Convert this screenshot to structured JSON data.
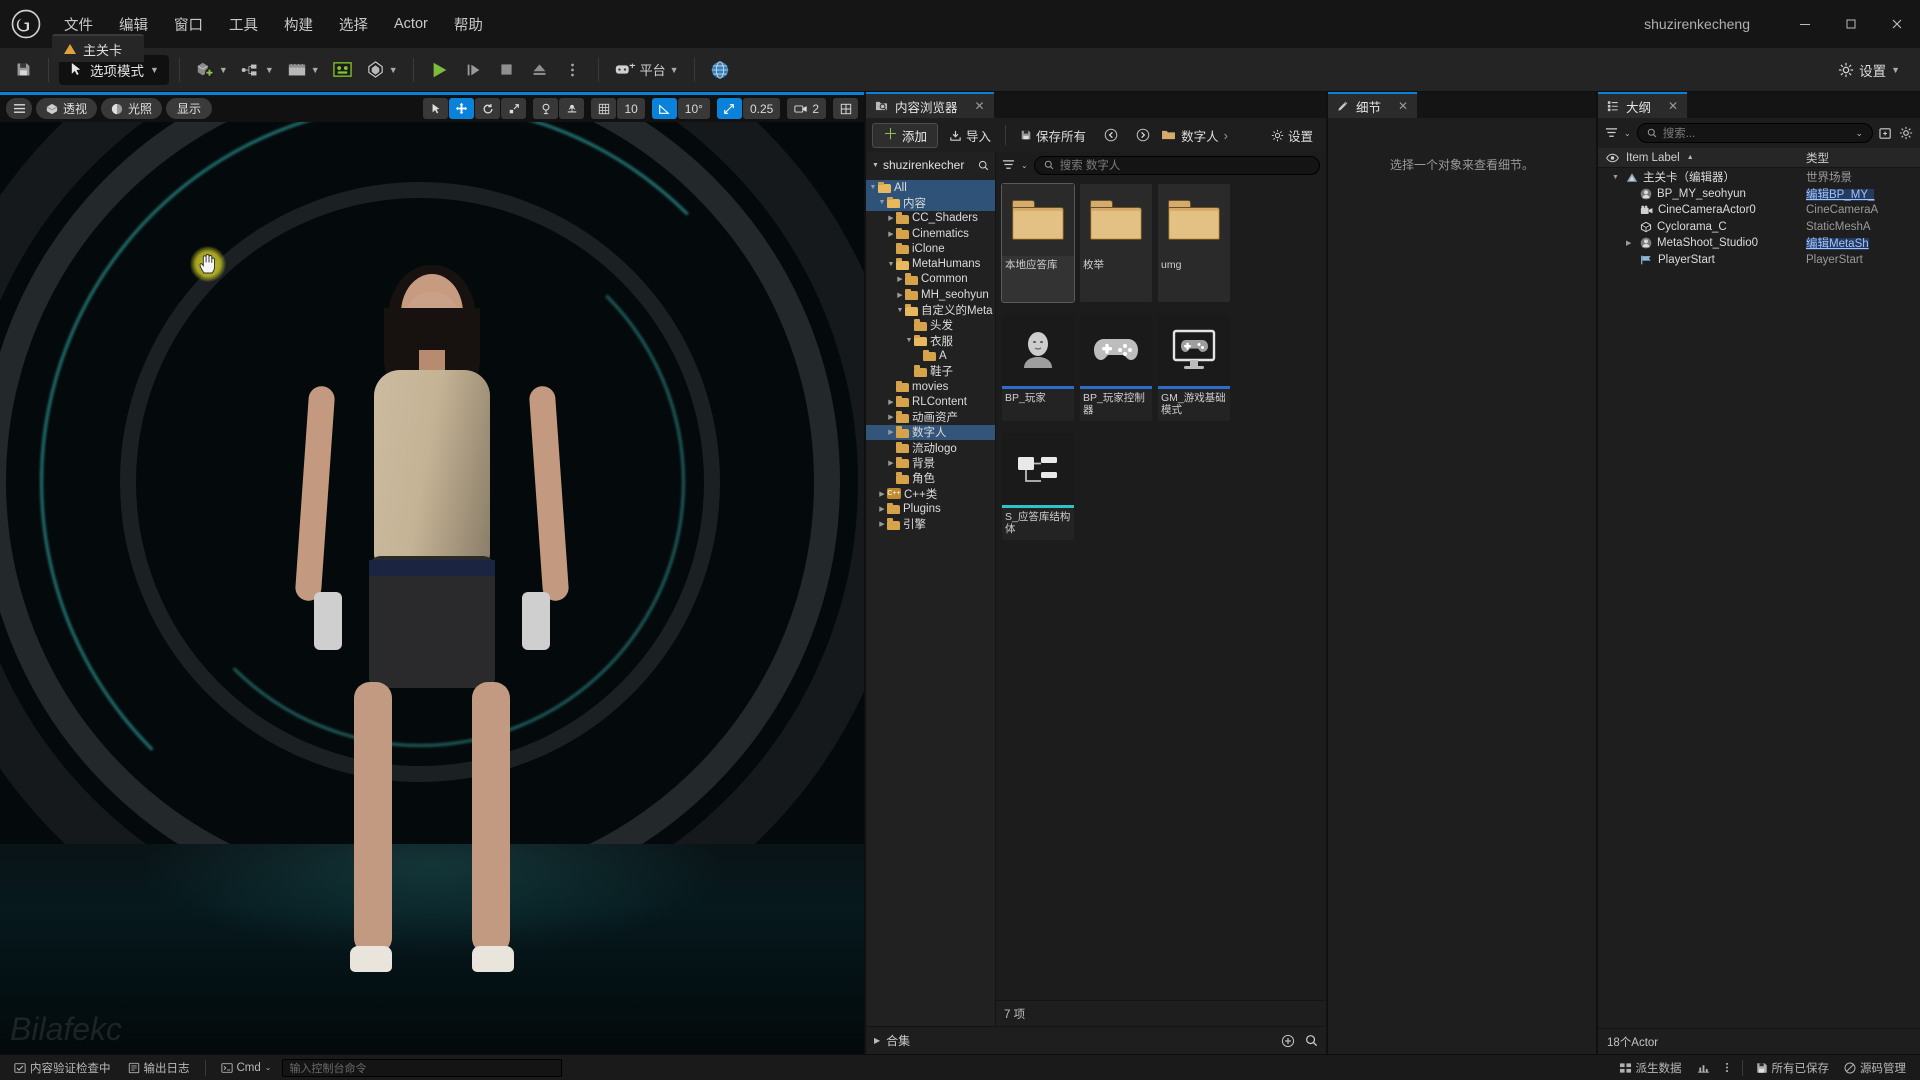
{
  "window": {
    "project_title": "shuzirenkecheng",
    "minimize": "—",
    "maximize": "▢",
    "close": "✕"
  },
  "menu": {
    "items": [
      {
        "label": "文件"
      },
      {
        "label": "编辑"
      },
      {
        "label": "窗口"
      },
      {
        "label": "工具"
      },
      {
        "label": "构建"
      },
      {
        "label": "选择"
      },
      {
        "label": "Actor"
      },
      {
        "label": "帮助"
      }
    ]
  },
  "level_tab": {
    "label": "主关卡"
  },
  "toolbar": {
    "save_icon": "save-icon",
    "mode_label": "选项模式",
    "add_icon": "add-actor-icon",
    "blueprint_icon": "blueprint-icon",
    "cinematics_icon": "cinematics-icon",
    "sequencer_icon": "sequencer-icon",
    "effects_icon": "effects-icon",
    "play_icon": "play-icon",
    "skip_icon": "skip-icon",
    "stop_icon": "stop-icon",
    "eject_icon": "eject-icon",
    "more_icon": "more-options-icon",
    "platform_label": "平台",
    "globe_icon": "world-settings-icon",
    "settings_label": "设置"
  },
  "viewport": {
    "menu_icon": "viewport-menu-icon",
    "perspective_label": "透视",
    "lit_label": "光照",
    "show_label": "显示",
    "tools": [
      {
        "name": "select-tool-icon",
        "active": false
      },
      {
        "name": "move-tool-icon",
        "active": true
      },
      {
        "name": "rotate-tool-icon",
        "active": false
      },
      {
        "name": "scale-tool-icon",
        "active": false
      }
    ],
    "world_coord_icon": "world-coordinate-icon",
    "surface_snap_icon": "surface-snap-icon",
    "grid_snap_icon": "grid-snap-icon",
    "grid_snap_value": "10",
    "angle_snap_icon": "angle-snap-icon",
    "angle_snap_value": "10°",
    "scale_snap_icon": "scale-snap-icon",
    "scale_snap_value": "0.25",
    "camera_speed_icon": "camera-speed-icon",
    "camera_speed_value": "2",
    "layout_icon": "viewport-layout-icon",
    "watermark": "Bilafekc"
  },
  "content_browser": {
    "tab_label": "内容浏览器",
    "tab_icon": "content-browser-icon",
    "close_icon": "close-icon",
    "add_label": "添加",
    "import_label": "导入",
    "save_all_label": "保存所有",
    "back_icon": "back-arrow-icon",
    "forward_icon": "forward-arrow-icon",
    "path_folder_icon": "folder-icon",
    "path_label": "数字人",
    "path_chevron": "›",
    "settings_label": "设置",
    "tree_root_label": "shuzirenkecher",
    "tree_search_icon": "search-icon",
    "tree": [
      {
        "label": "All",
        "depth": 0,
        "arrow": "▼",
        "selected": true,
        "open": true
      },
      {
        "label": "内容",
        "depth": 1,
        "arrow": "▼",
        "selected": true,
        "open": true
      },
      {
        "label": "CC_Shaders",
        "depth": 2,
        "arrow": "▶"
      },
      {
        "label": "Cinematics",
        "depth": 2,
        "arrow": "▶"
      },
      {
        "label": "iClone",
        "depth": 2,
        "arrow": ""
      },
      {
        "label": "MetaHumans",
        "depth": 2,
        "arrow": "▼",
        "open": true
      },
      {
        "label": "Common",
        "depth": 3,
        "arrow": "▶"
      },
      {
        "label": "MH_seohyun",
        "depth": 3,
        "arrow": "▶"
      },
      {
        "label": "自定义的Meta",
        "depth": 3,
        "arrow": "▼",
        "open": true
      },
      {
        "label": "头发",
        "depth": 4,
        "arrow": ""
      },
      {
        "label": "衣服",
        "depth": 4,
        "arrow": "▼",
        "open": true
      },
      {
        "label": "A",
        "depth": 5,
        "arrow": ""
      },
      {
        "label": "鞋子",
        "depth": 4,
        "arrow": ""
      },
      {
        "label": "movies",
        "depth": 2,
        "arrow": ""
      },
      {
        "label": "RLContent",
        "depth": 2,
        "arrow": "▶"
      },
      {
        "label": "动画资产",
        "depth": 2,
        "arrow": "▶"
      },
      {
        "label": "数字人",
        "depth": 2,
        "arrow": "▶",
        "highlight": true
      },
      {
        "label": "流动logo",
        "depth": 2,
        "arrow": ""
      },
      {
        "label": "背景",
        "depth": 2,
        "arrow": "▶"
      },
      {
        "label": "角色",
        "depth": 2,
        "arrow": ""
      },
      {
        "label": "C++类",
        "depth": 1,
        "arrow": "▶",
        "cpp": true
      },
      {
        "label": "Plugins",
        "depth": 1,
        "arrow": "▶"
      },
      {
        "label": "引擎",
        "depth": 1,
        "arrow": "▶"
      }
    ],
    "filter_icon": "filter-icon",
    "filter_chevron": "⌄",
    "search_placeholder": "搜索 数字人",
    "search_icon": "search-icon",
    "assets": [
      {
        "label": "本地应答库",
        "kind": "folder",
        "selected": true
      },
      {
        "label": "枚举",
        "kind": "folder",
        "selected": false
      },
      {
        "label": "umg",
        "kind": "folder",
        "selected": false
      },
      {
        "label": "BP_玩家",
        "kind": "blueprint",
        "icon": "character-icon",
        "bar": "blueprint"
      },
      {
        "label": "BP_玩家控制器",
        "kind": "blueprint",
        "icon": "gamepad-icon",
        "bar": "blueprint"
      },
      {
        "label": "GM_游戏基础模式",
        "kind": "blueprint",
        "icon": "gamemode-icon",
        "bar": "blueprint"
      },
      {
        "label": "S_应答库结构体",
        "kind": "struct",
        "icon": "struct-icon",
        "bar": "struct"
      }
    ],
    "item_count": "7 项",
    "collection_label": "合集",
    "collection_add_icon": "add-collection-icon",
    "collection_search_icon": "search-icon"
  },
  "details": {
    "tab_label": "细节",
    "tab_icon": "details-icon",
    "close_icon": "close-icon",
    "empty_message": "选择一个对象来查看细节。"
  },
  "outliner": {
    "tab_label": "大纲",
    "tab_icon": "outliner-icon",
    "close_icon": "close-icon",
    "filter_icon": "filter-icon",
    "filter_chevron": "⌄",
    "search_placeholder": "搜索...",
    "search_icon": "search-icon",
    "dropdown_chevron": "⌄",
    "save_icon": "save-outliner-icon",
    "settings_icon": "gear-icon",
    "col_eye_icon": "eye-icon",
    "col_item_label": "Item Label",
    "col_sort_arrow": "▲",
    "col_type": "类型",
    "rows": [
      {
        "label": "主关卡（编辑器）",
        "type": "世界场景",
        "depth": 0,
        "arrow": "▼",
        "icon": "level-icon",
        "link": false
      },
      {
        "label": "BP_MY_seohyun",
        "type": "编辑BP_MY_",
        "depth": 1,
        "arrow": "",
        "icon": "actor-icon",
        "link": true
      },
      {
        "label": "CineCameraActor0",
        "type": "CineCameraA",
        "depth": 1,
        "arrow": "",
        "icon": "camera-icon",
        "link": false
      },
      {
        "label": "Cyclorama_C",
        "type": "StaticMeshA",
        "depth": 1,
        "arrow": "",
        "icon": "mesh-icon",
        "link": false
      },
      {
        "label": "MetaShoot_Studio0",
        "type": "编辑MetaSh",
        "depth": 1,
        "arrow": "▶",
        "icon": "actor-icon",
        "link": true
      },
      {
        "label": "PlayerStart",
        "type": "PlayerStart",
        "depth": 1,
        "arrow": "",
        "icon": "playerstart-icon",
        "link": false
      }
    ],
    "footer": "18个Actor"
  },
  "status_bar": {
    "content_label": "内容验证检查中",
    "content_icon": "content-check-icon",
    "output_log_label": "输出日志",
    "output_log_icon": "output-log-icon",
    "cmd_label": "Cmd",
    "cmd_icon": "console-icon",
    "cmd_chevron": "⌄",
    "cmd_placeholder": "输入控制台命令",
    "derived_data_label": "派生数据",
    "derived_data_icon": "derived-data-icon",
    "perf_icon": "performance-icon",
    "more_icon": "more-icon",
    "all_saved_label": "所有已保存",
    "all_saved_icon": "save-state-icon",
    "source_control_label": "源码管理",
    "source_control_icon": "source-control-icon"
  },
  "colors": {
    "accent_blue": "#0b82d9",
    "folder": "#d4ab6b",
    "blueprint_bar": "#2d6cc9",
    "struct_bar": "#2ec4c4",
    "cursor_glow": "#e1de28",
    "panel_bg": "#1e1e1e",
    "toolbar_bg": "#242424"
  }
}
